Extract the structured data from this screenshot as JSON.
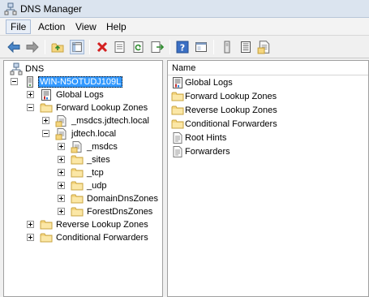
{
  "window": {
    "title": "DNS Manager"
  },
  "menu": {
    "items": [
      {
        "label": "File"
      },
      {
        "label": "Action"
      },
      {
        "label": "View"
      },
      {
        "label": "Help"
      }
    ]
  },
  "toolbar": {
    "buttons": [
      "back-arrow-icon",
      "forward-arrow-icon",
      "up-one-level-icon",
      "show-hide-tree-icon",
      "delete-icon",
      "properties-icon",
      "refresh-icon",
      "export-list-icon",
      "help-icon",
      "new-window-icon",
      "server-icon",
      "log-icon",
      "zone-icon"
    ]
  },
  "tree": {
    "root": "DNS",
    "server": "WIN-N5OTUDJ109L",
    "global_logs": "Global Logs",
    "forward_zones": "Forward Lookup Zones",
    "msdcs_zone": "_msdcs.jdtech.local",
    "jdtech_zone": "jdtech.local",
    "children": [
      "_msdcs",
      "_sites",
      "_tcp",
      "_udp",
      "DomainDnsZones",
      "ForestDnsZones"
    ],
    "reverse_zones": "Reverse Lookup Zones",
    "conditional_forwarders": "Conditional Forwarders"
  },
  "list": {
    "column_name": "Name",
    "items": [
      {
        "label": "Global Logs",
        "icon": "log-icon"
      },
      {
        "label": "Forward Lookup Zones",
        "icon": "folder-icon"
      },
      {
        "label": "Reverse Lookup Zones",
        "icon": "folder-icon"
      },
      {
        "label": "Conditional Forwarders",
        "icon": "folder-icon"
      },
      {
        "label": "Root Hints",
        "icon": "document-icon"
      },
      {
        "label": "Forwarders",
        "icon": "document-icon"
      }
    ]
  },
  "colors": {
    "selection": "#3399ff",
    "folder": "#f5d680",
    "titlebar": "#dbe4ef"
  }
}
